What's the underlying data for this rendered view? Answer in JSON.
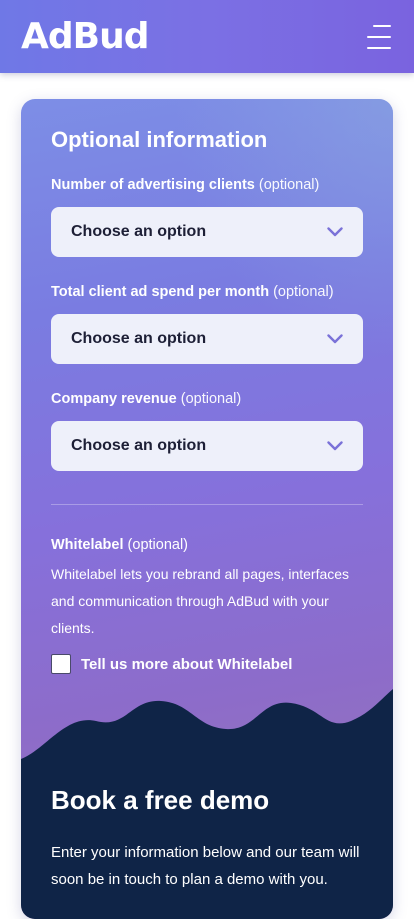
{
  "header": {
    "logo": "AdBud",
    "menu_icon": "hamburger-menu-icon"
  },
  "form": {
    "title": "Optional information",
    "fields": [
      {
        "label": "Number of advertising clients",
        "optional": "(optional)",
        "value": "Choose an option"
      },
      {
        "label": "Total client ad spend per month",
        "optional": "(optional)",
        "value": "Choose an option"
      },
      {
        "label": "Company revenue",
        "optional": "(optional)",
        "value": "Choose an option"
      }
    ],
    "whitelabel": {
      "label": "Whitelabel",
      "optional": "(optional)",
      "description": "Whitelabel lets you rebrand all pages, interfaces and communication through AdBud with your clients.",
      "checkbox_label": "Tell us more about Whitelabel",
      "checked": false
    }
  },
  "demo": {
    "title": "Book a free demo",
    "text": "Enter your information below and our team will soon be in touch to plan a demo with you."
  },
  "colors": {
    "header": "#7a70e4",
    "select_bg": "#eef0fa",
    "dark_navy": "#0f2447",
    "text_dark": "#1d1f36"
  }
}
